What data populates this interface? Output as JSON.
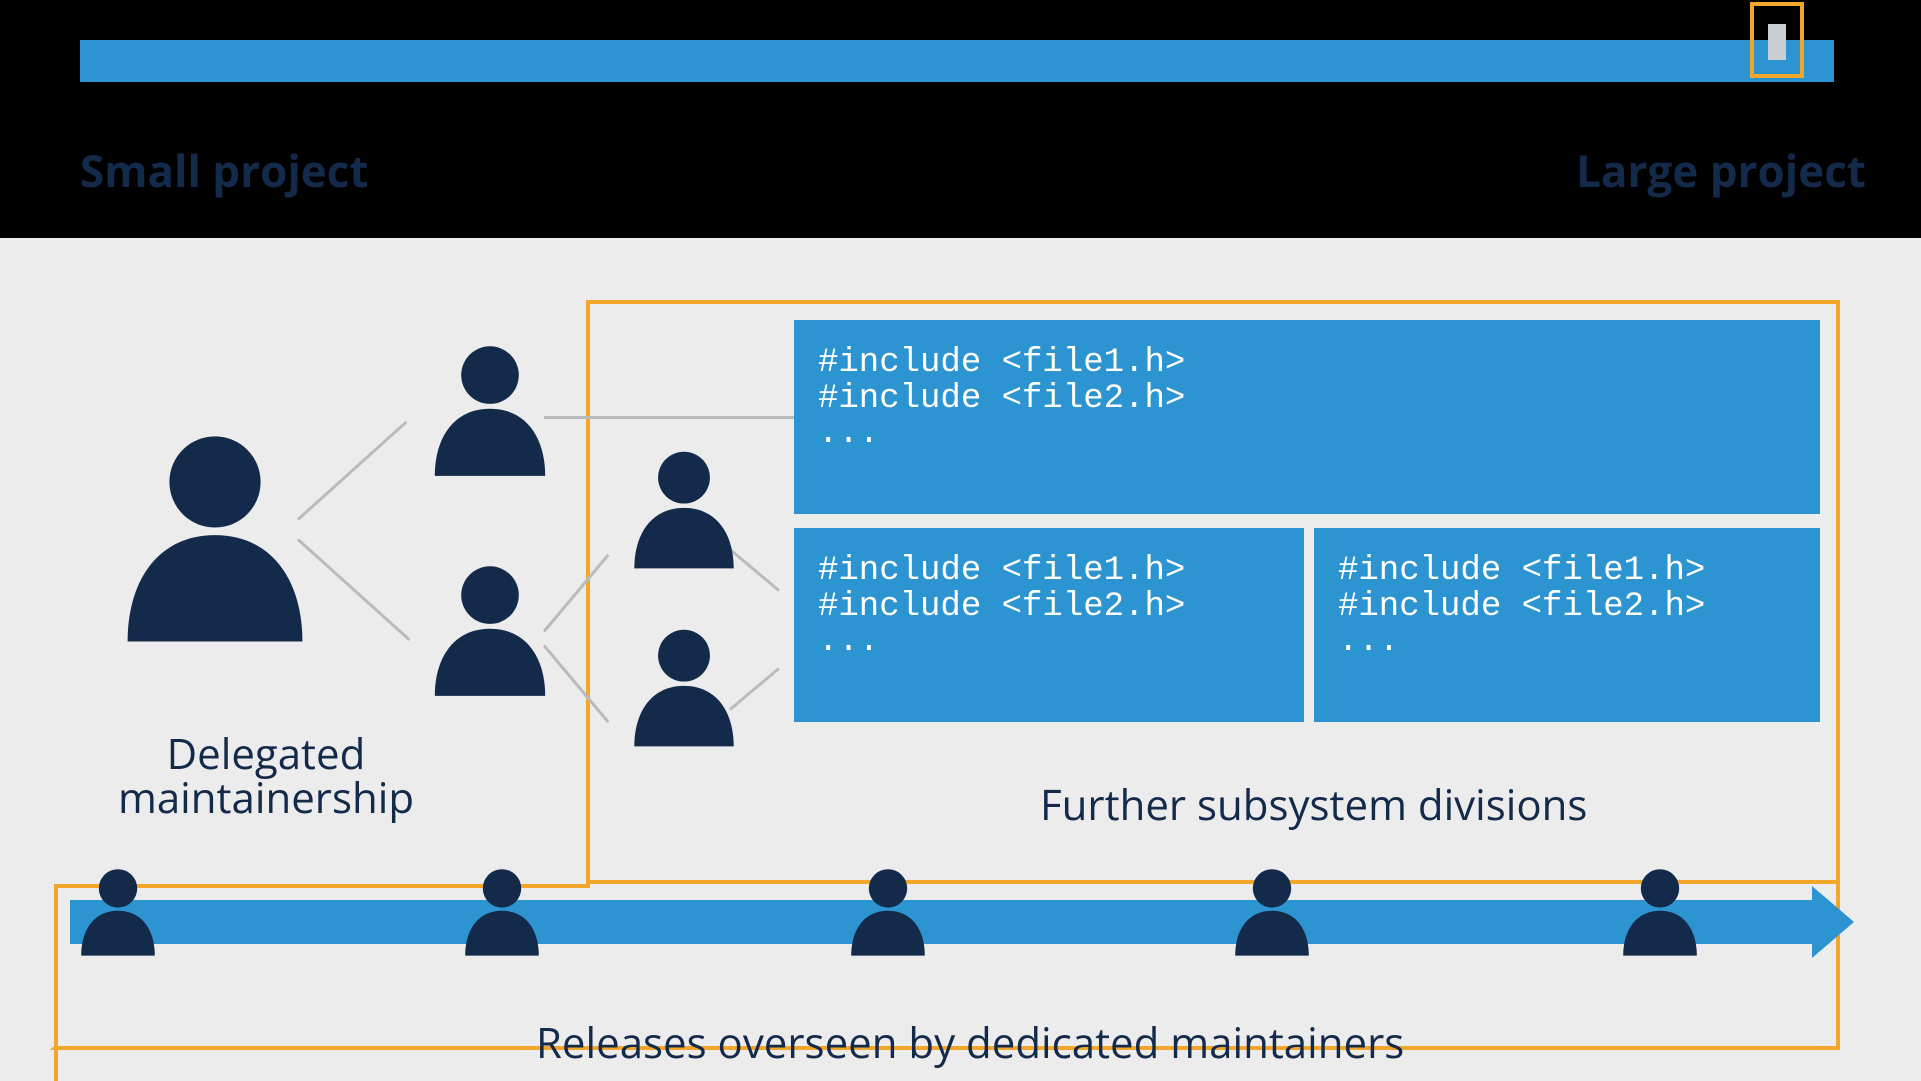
{
  "top": {
    "label_left": "Small project",
    "label_right": "Large project"
  },
  "code": {
    "block1": "#include <file1.h>\n#include <file2.h>\n...",
    "block2": "#include <file1.h>\n#include <file2.h>\n...",
    "block3": "#include <file1.h>\n#include <file2.h>\n..."
  },
  "labels": {
    "delegated": "Delegated\nmaintainership",
    "further": "Further subsystem divisions",
    "releases": "Releases overseen by dedicated maintainers"
  },
  "colors": {
    "blue": "#2c94d1",
    "navy": "#132a4a",
    "orange": "#f2a62b",
    "grey_bg": "#ececec",
    "line_grey": "#b9bcbe"
  }
}
